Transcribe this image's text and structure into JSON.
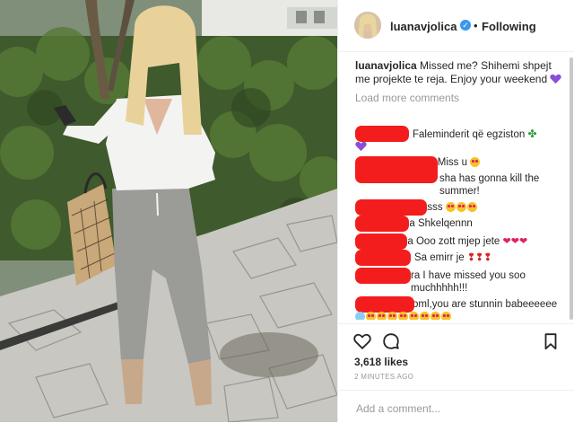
{
  "post": {
    "username": "luanavjolica",
    "follow_status": "Following",
    "separator": "•",
    "verified_icon": "verified-badge-icon"
  },
  "caption": {
    "username": "luanavjolica",
    "text": "Missed me? Shihemi shpejt me projekte te reja. Enjoy your weekend",
    "emoji": "purple-heart"
  },
  "load_more_label": "Load more comments",
  "comments": [
    {
      "text": "Faleminderit që egziston",
      "emoji": [
        "four-leaf-clover",
        "purple-heart"
      ]
    },
    {
      "text": "i Miss u",
      "emoji": [
        "heart-eyes"
      ]
    },
    {
      "text": "sha has gonna kill the summer!",
      "emoji": []
    },
    {
      "text": "asss",
      "emoji": [
        "heart-eyes",
        "heart-eyes",
        "heart-eyes"
      ]
    },
    {
      "text": "na Shkelqennn",
      "emoji": []
    },
    {
      "text": "na Ooo zott mjep jete",
      "emoji": [
        "red-heart",
        "red-heart",
        "red-heart"
      ]
    },
    {
      "text": "Sa emirr je",
      "emoji": [
        "red-exclamation",
        "red-exclamation",
        "red-exclamation"
      ]
    },
    {
      "text": "ra I have missed you soo muchhhhh!!!",
      "emoji": []
    },
    {
      "text": "oml,you are stunnin babeeeeee",
      "emoji": [
        "crying-laughing",
        "heart-eyes",
        "heart-eyes",
        "heart-eyes",
        "heart-eyes",
        "heart-eyes",
        "heart-eyes",
        "heart-eyes",
        "heart-eyes"
      ]
    }
  ],
  "likes_label": "3,618 likes",
  "time_label": "2 MINUTES AGO",
  "add_comment_placeholder": "Add a comment...",
  "colors": {
    "accent_blue": "#3897f0",
    "redaction": "#f31d1d",
    "muted_text": "#999999",
    "text": "#262626"
  },
  "icons": [
    "heart-icon",
    "comment-icon",
    "bookmark-icon",
    "more-options-icon"
  ]
}
